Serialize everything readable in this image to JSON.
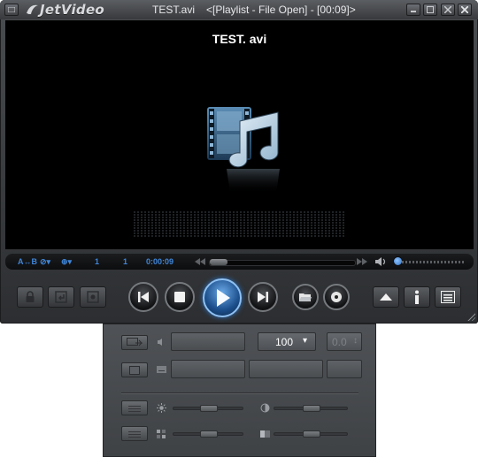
{
  "window": {
    "brand": "JetVideo",
    "file_name": "TEST.avi",
    "status": "<[Playlist - File Open] - [00:09]>"
  },
  "video": {
    "osd_title": "TEST. avi",
    "center_icon": "film-music-note-icon"
  },
  "statusbar": {
    "ab_repeat": "A↔B",
    "subtitle_toggle": "⊘▾",
    "audio_toggle": "⊕▾",
    "track_number": "1",
    "playlist_count": "1",
    "elapsed_time": "0:00:09",
    "seek_progress": 0.0,
    "volume_level": 0.0
  },
  "controls": {
    "left": [
      "lock-icon",
      "return-icon",
      "record-icon"
    ],
    "transport": [
      "previous-icon",
      "stop-icon",
      "play-icon",
      "next-icon"
    ],
    "media": [
      "open-folder-icon",
      "disc-icon"
    ],
    "right": [
      "eject-icon",
      "info-icon",
      "menu-icon"
    ]
  },
  "panel": {
    "zoom_value": "100",
    "zoom_dropdown_arrow": "▾",
    "speed_value": "0.0",
    "speed_spinner_arrows": "↕",
    "brightness_level": 0.5,
    "contrast_level": 0.5,
    "saturation_level": 0.5,
    "hue_level": 0.5
  },
  "colors": {
    "accent": "#3f86d9",
    "play_glow": "#2c74c4",
    "chrome_dark": "#2c2e31"
  }
}
